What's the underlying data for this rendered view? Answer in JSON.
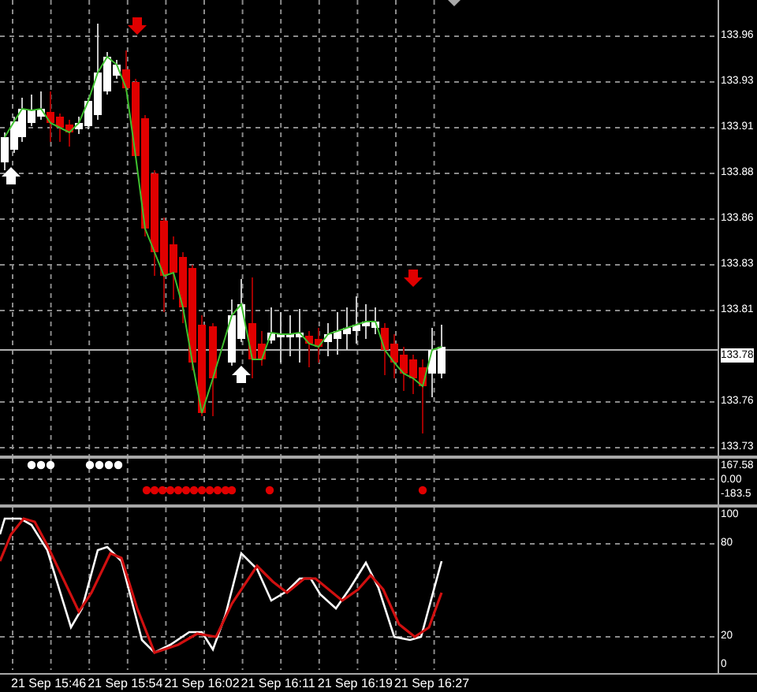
{
  "price_axis": [
    {
      "label": "133.96",
      "current": false
    },
    {
      "label": "133.93",
      "current": false
    },
    {
      "label": "133.91",
      "current": false
    },
    {
      "label": "133.88",
      "current": false
    },
    {
      "label": "133.86",
      "current": false
    },
    {
      "label": "133.83",
      "current": false
    },
    {
      "label": "133.81",
      "current": false
    },
    {
      "label": "133.78",
      "current": true
    },
    {
      "label": "133.76",
      "current": false
    },
    {
      "label": "133.73",
      "current": false
    }
  ],
  "indicator_axis": [
    "167.58",
    "0.00",
    "-183.5"
  ],
  "oscillator_axis": [
    "100",
    "80",
    "20",
    "0"
  ],
  "time_axis": [
    "21 Sep 15:46",
    "21 Sep 15:54",
    "21 Sep 16:02",
    "21 Sep 16:11",
    "21 Sep 16:19",
    "21 Sep 16:27"
  ]
}
